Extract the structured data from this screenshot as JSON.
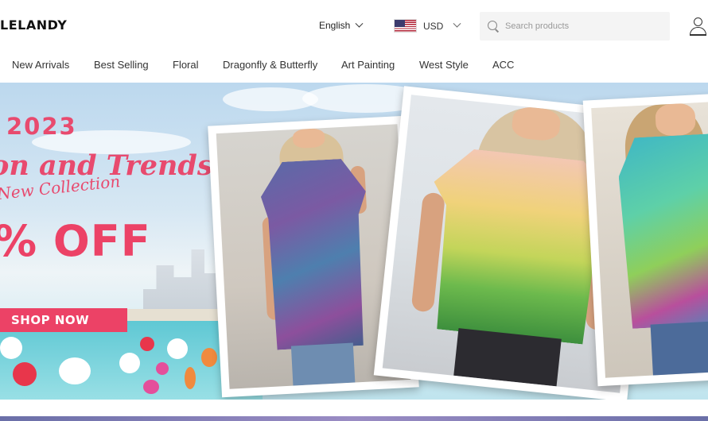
{
  "header": {
    "logo_text": "LELANDY",
    "language": "English",
    "currency": "USD",
    "search_placeholder": "Search products"
  },
  "nav": {
    "items": [
      {
        "label": "New Arrivals"
      },
      {
        "label": "Best Selling"
      },
      {
        "label": "Floral"
      },
      {
        "label": "Dragonfly & Butterfly"
      },
      {
        "label": "Art Painting"
      },
      {
        "label": "West Style"
      },
      {
        "label": "ACC"
      }
    ]
  },
  "banner": {
    "year": "2023",
    "headline": "on and Trends",
    "subheadline": "New Collection",
    "discount": "% OFF",
    "cta": "SHOP NOW"
  },
  "colors": {
    "accent": "#ec4266",
    "sky": "#bcd8ee",
    "sea": "#5fc8d4"
  },
  "icons": [
    "chevron-down-icon",
    "us-flag-icon",
    "search-icon",
    "user-icon"
  ]
}
